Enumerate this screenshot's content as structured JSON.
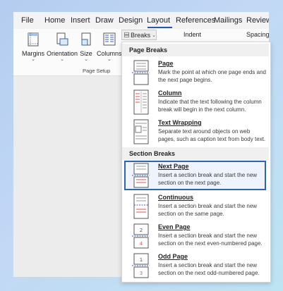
{
  "tabs": [
    "File",
    "Home",
    "Insert",
    "Draw",
    "Design",
    "Layout",
    "References",
    "Mailings",
    "Review"
  ],
  "ribbon": {
    "buttons": [
      "Margins",
      "Orientation",
      "Size",
      "Columns"
    ],
    "group_label": "Page Setup",
    "breaks_label": "Breaks",
    "indent_label": "Indent",
    "spacing_label": "Spacing"
  },
  "menu": {
    "page_breaks_header": "Page Breaks",
    "section_breaks_header": "Section Breaks",
    "items": [
      {
        "title": "Page",
        "desc": "Mark the point at which one page ends and the next page begins.",
        "icon": "page-break-icon"
      },
      {
        "title": "Column",
        "desc": "Indicate that the text following the column break will begin in the next column.",
        "icon": "column-break-icon"
      },
      {
        "title": "Text Wrapping",
        "desc": "Separate text around objects on web pages, such as caption text from body text.",
        "icon": "text-wrapping-icon"
      },
      {
        "title": "Next Page",
        "desc": "Insert a section break and start the new section on the next page.",
        "icon": "next-page-icon"
      },
      {
        "title": "Continuous",
        "desc": "Insert a section break and start the new section on the same page.",
        "icon": "continuous-icon"
      },
      {
        "title": "Even Page",
        "desc": "Insert a section break and start the new section on the next even-numbered page.",
        "icon": "even-page-icon"
      },
      {
        "title": "Odd Page",
        "desc": "Insert a section break and start the new section on the next odd-numbered page.",
        "icon": "odd-page-icon"
      }
    ]
  },
  "colors": {
    "accent": "#185abd",
    "selection": "#2e64b8"
  }
}
